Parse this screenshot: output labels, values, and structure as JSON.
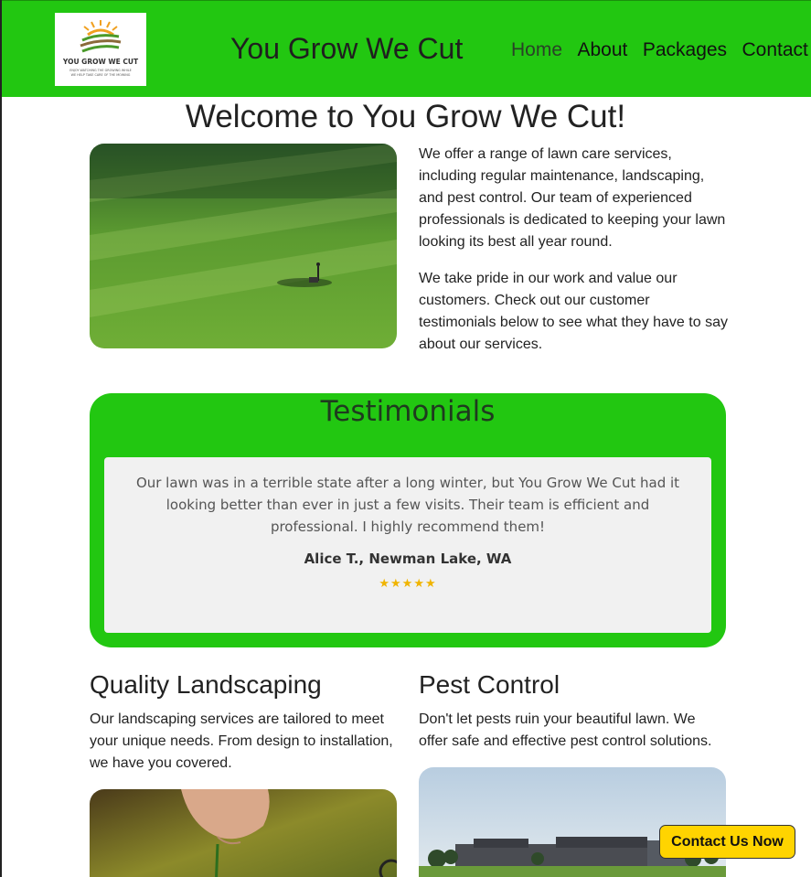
{
  "header": {
    "logo_text": "YOU GROW WE CUT",
    "logo_tagline_1": "ENJOY WATCHING THE GROWING WHILE",
    "logo_tagline_2": "WE HELP TAKE CARE OF THE MOWING",
    "site_title": "You Grow We Cut",
    "nav": [
      "Home",
      "About",
      "Packages",
      "Contact"
    ]
  },
  "welcome": "Welcome to You Grow We Cut!",
  "intro": {
    "p1": "We offer a range of lawn care services, including regular maintenance, landscaping, and pest control. Our team of experienced professionals is dedicated to keeping your lawn looking its best all year round.",
    "p2": "We take pride in our work and value our customers. Check out our customer testimonials below to see what they have to say about our services."
  },
  "testimonials": {
    "title": "Testimonials",
    "quote": "Our lawn was in a terrible state after a long winter, but You Grow We Cut had it looking better than ever in just a few visits. Their team is efficient and professional. I highly recommend them!",
    "author": "Alice T., Newman Lake, WA",
    "stars": "★★★★★"
  },
  "services": {
    "landscaping_title": "Quality Landscaping",
    "landscaping_text": "Our landscaping services are tailored to meet your unique needs. From design to installation, we have you covered.",
    "pest_title": "Pest Control",
    "pest_text": "Don't let pests ruin your beautiful lawn. We offer safe and effective pest control solutions."
  },
  "contact_button": "Contact Us Now",
  "colors": {
    "brand_green": "#22c711",
    "button_yellow": "#ffd400",
    "star_gold": "#f0b400"
  }
}
